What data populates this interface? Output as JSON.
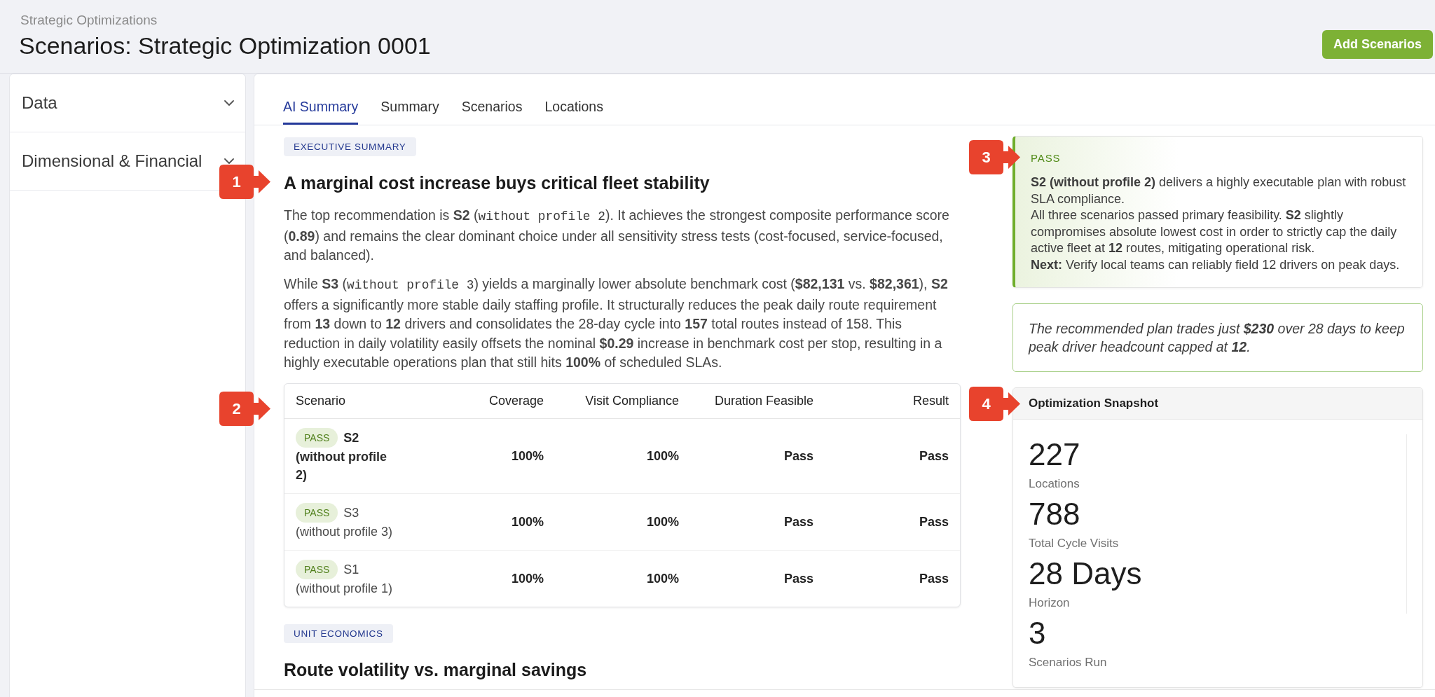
{
  "header": {
    "breadcrumb": "Strategic Optimizations",
    "title": "Scenarios: Strategic Optimization 0001",
    "action_button": "Add Scenarios"
  },
  "sidebar": {
    "items": [
      {
        "label": "Data",
        "expanded": false
      },
      {
        "label": "Dimensional & Financial",
        "expanded": false
      }
    ]
  },
  "tabs": [
    {
      "label": "AI Summary",
      "selected": true
    },
    {
      "label": "Summary",
      "selected": false
    },
    {
      "label": "Scenarios",
      "selected": false
    },
    {
      "label": "Locations",
      "selected": false
    }
  ],
  "executive_summary": {
    "tag": "EXECUTIVE SUMMARY",
    "callout": "1",
    "heading": "A marginal cost increase buys critical fleet stability",
    "paragraphs": [
      {
        "runs": [
          {
            "kind": "text",
            "text": "The top recommendation is **S2** ("
          },
          {
            "kind": "code",
            "text": "without profile 2"
          },
          {
            "kind": "text",
            "text": "). It achieves the strongest composite performance score (**0.89**) and remains the clear dominant choice under all sensitivity stress tests (cost-focused, service-focused, and balanced)."
          }
        ]
      },
      {
        "runs": [
          {
            "kind": "text",
            "text": "While **S3** ("
          },
          {
            "kind": "code",
            "text": "without profile 3"
          },
          {
            "kind": "text",
            "text": ") yields a marginally lower absolute benchmark cost (**$82,131** vs. **$82,361**), **S2** offers a significantly more stable daily staffing profile. It structurally reduces the peak daily route requirement from **13** down to **12** drivers and consolidates the 28-day cycle into **157** total routes instead of 158. This reduction in daily volatility easily offsets the nominal **$0.29** increase in benchmark cost per stop, resulting in a highly executable operations plan that still hits **100%** of scheduled SLAs."
          }
        ]
      }
    ]
  },
  "scenario_table": {
    "callout": "2",
    "columns": [
      "Scenario",
      "Coverage",
      "Visit Compliance",
      "Duration Feasible",
      "Result"
    ],
    "rows": [
      {
        "highlighted": true,
        "cells": [
          {
            "kind": "scenario",
            "badge": "PASS",
            "name": "S2",
            "detail": "(without profile 2)"
          },
          {
            "kind": "value",
            "text": "100%"
          },
          {
            "kind": "value",
            "text": "100%"
          },
          {
            "kind": "value",
            "text": "Pass"
          },
          {
            "kind": "value",
            "text": "Pass"
          }
        ]
      },
      {
        "highlighted": false,
        "cells": [
          {
            "kind": "scenario",
            "badge": "PASS",
            "name": "S3",
            "detail": "(without profile 3)"
          },
          {
            "kind": "value",
            "text": "100%"
          },
          {
            "kind": "value",
            "text": "100%"
          },
          {
            "kind": "value",
            "text": "Pass"
          },
          {
            "kind": "value",
            "text": "Pass"
          }
        ]
      },
      {
        "highlighted": false,
        "cells": [
          {
            "kind": "scenario",
            "badge": "PASS",
            "name": "S1",
            "detail": "(without profile 1)"
          },
          {
            "kind": "value",
            "text": "100%"
          },
          {
            "kind": "value",
            "text": "100%"
          },
          {
            "kind": "value",
            "text": "Pass"
          },
          {
            "kind": "value",
            "text": "Pass"
          }
        ]
      }
    ]
  },
  "unit_economics": {
    "tag": "UNIT ECONOMICS",
    "heading": "Route volatility vs. marginal savings"
  },
  "verdict_card": {
    "callout": "3",
    "label": "PASS",
    "lines": [
      "**S2 (without profile 2)** delivers a highly executable plan with robust SLA compliance.",
      "All three scenarios passed primary feasibility. **S2** slightly compromises absolute lowest cost in order to strictly cap the daily active fleet at **12** routes, mitigating operational risk.",
      "**Next:** Verify local teams can reliably field 12 drivers on peak days."
    ]
  },
  "takeaway": {
    "text": "The recommended plan trades just **$230** over 28 days to keep peak driver headcount capped at **12**."
  },
  "snapshot": {
    "callout": "4",
    "title": "Optimization Snapshot",
    "metrics": [
      {
        "value": "227",
        "label": "Locations"
      },
      {
        "value": "788",
        "label": "Total Cycle Visits"
      },
      {
        "value": "28 Days",
        "label": "Horizon"
      },
      {
        "value": "3",
        "label": "Scenarios Run"
      }
    ]
  }
}
